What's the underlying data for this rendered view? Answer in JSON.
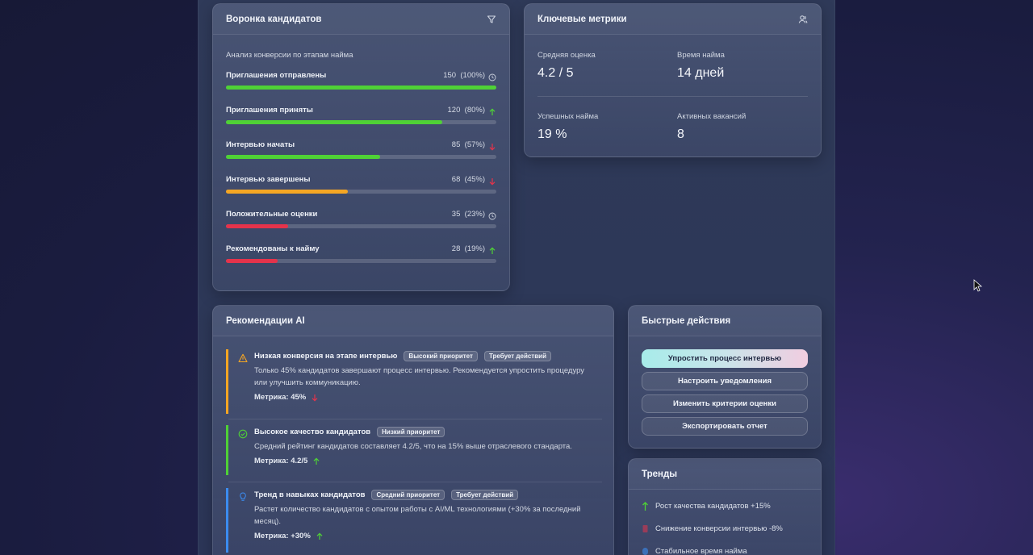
{
  "funnel": {
    "title": "Воронка кандидатов",
    "subtitle": "Анализ конверсии по этапам найма",
    "stages": [
      {
        "label": "Приглашения отправлены",
        "count": "150",
        "pct": "(100%)",
        "fraction": 1.0,
        "color": "#4fd136",
        "icon": "clock-icon"
      },
      {
        "label": "Приглашения приняты",
        "count": "120",
        "pct": "(80%)",
        "fraction": 0.8,
        "color": "#4fd136",
        "icon": "arrow-up-icon"
      },
      {
        "label": "Интервью начаты",
        "count": "85",
        "pct": "(57%)",
        "fraction": 0.57,
        "color": "#4fd136",
        "icon": "arrow-down-icon"
      },
      {
        "label": "Интервью завершены",
        "count": "68",
        "pct": "(45%)",
        "fraction": 0.45,
        "color": "#f5a623",
        "icon": "arrow-down-icon"
      },
      {
        "label": "Положительные оценки",
        "count": "35",
        "pct": "(23%)",
        "fraction": 0.23,
        "color": "#e5334b",
        "icon": "clock-icon"
      },
      {
        "label": "Рекомендованы к найму",
        "count": "28",
        "pct": "(19%)",
        "fraction": 0.19,
        "color": "#e5334b",
        "icon": "arrow-up-icon"
      }
    ]
  },
  "metrics": {
    "title": "Ключевые метрики",
    "items": [
      {
        "label": "Средняя оценка",
        "value": "4.2 / 5"
      },
      {
        "label": "Время найма",
        "value": "14 дней"
      },
      {
        "label": "Успешных найма",
        "value": "19 %"
      },
      {
        "label": "Активных вакансий",
        "value": "8"
      }
    ]
  },
  "ai": {
    "title": "Рекомендации AI",
    "recs": [
      {
        "title": "Низкая конверсия на этапе интервью",
        "badges": [
          "Высокий приоритет",
          "Требует действий"
        ],
        "text": "Только 45% кандидатов завершают процесс интервью. Рекомендуется упростить процедуру или улучшить коммуникацию.",
        "metric": "Метрика: 45%",
        "trend": "down",
        "accent": "#f5a623",
        "icon": "warning-icon"
      },
      {
        "title": "Высокое качество кандидатов",
        "badges": [
          "Низкий приоритет"
        ],
        "text": "Средний рейтинг кандидатов составляет 4.2/5, что на 15% выше отраслевого стандарта.",
        "metric": "Метрика: 4.2/5",
        "trend": "up",
        "accent": "#4fd136",
        "icon": "check-circle-icon"
      },
      {
        "title": "Тренд в навыках кандидатов",
        "badges": [
          "Средний приоритет",
          "Требует действий"
        ],
        "text": "Растет количество кандидатов с опытом работы с AI/ML технологиями (+30% за последний месяц).",
        "metric": "Метрика: +30%",
        "trend": "up",
        "accent": "#3b8cf0",
        "icon": "lightbulb-icon"
      }
    ]
  },
  "quick": {
    "title": "Быстрые действия",
    "actions": [
      "Упростить процесс интервью",
      "Настроить уведомления",
      "Изменить критерии оценки",
      "Экспортировать отчет"
    ]
  },
  "trends": {
    "title": "Тренды",
    "items": [
      {
        "label": "Рост качества кандидатов +15%",
        "color": "#4fd136",
        "icon": "trend-up-icon"
      },
      {
        "label": "Снижение конверсии интервью -8%",
        "color": "#e5334b",
        "icon": "trend-down-icon"
      },
      {
        "label": "Стабильное время найма",
        "color": "#3b8cf0",
        "icon": "trend-flat-icon"
      }
    ]
  },
  "colors": {
    "green": "#4fd136",
    "orange": "#f5a623",
    "red": "#e5334b",
    "blue": "#3b8cf0"
  }
}
